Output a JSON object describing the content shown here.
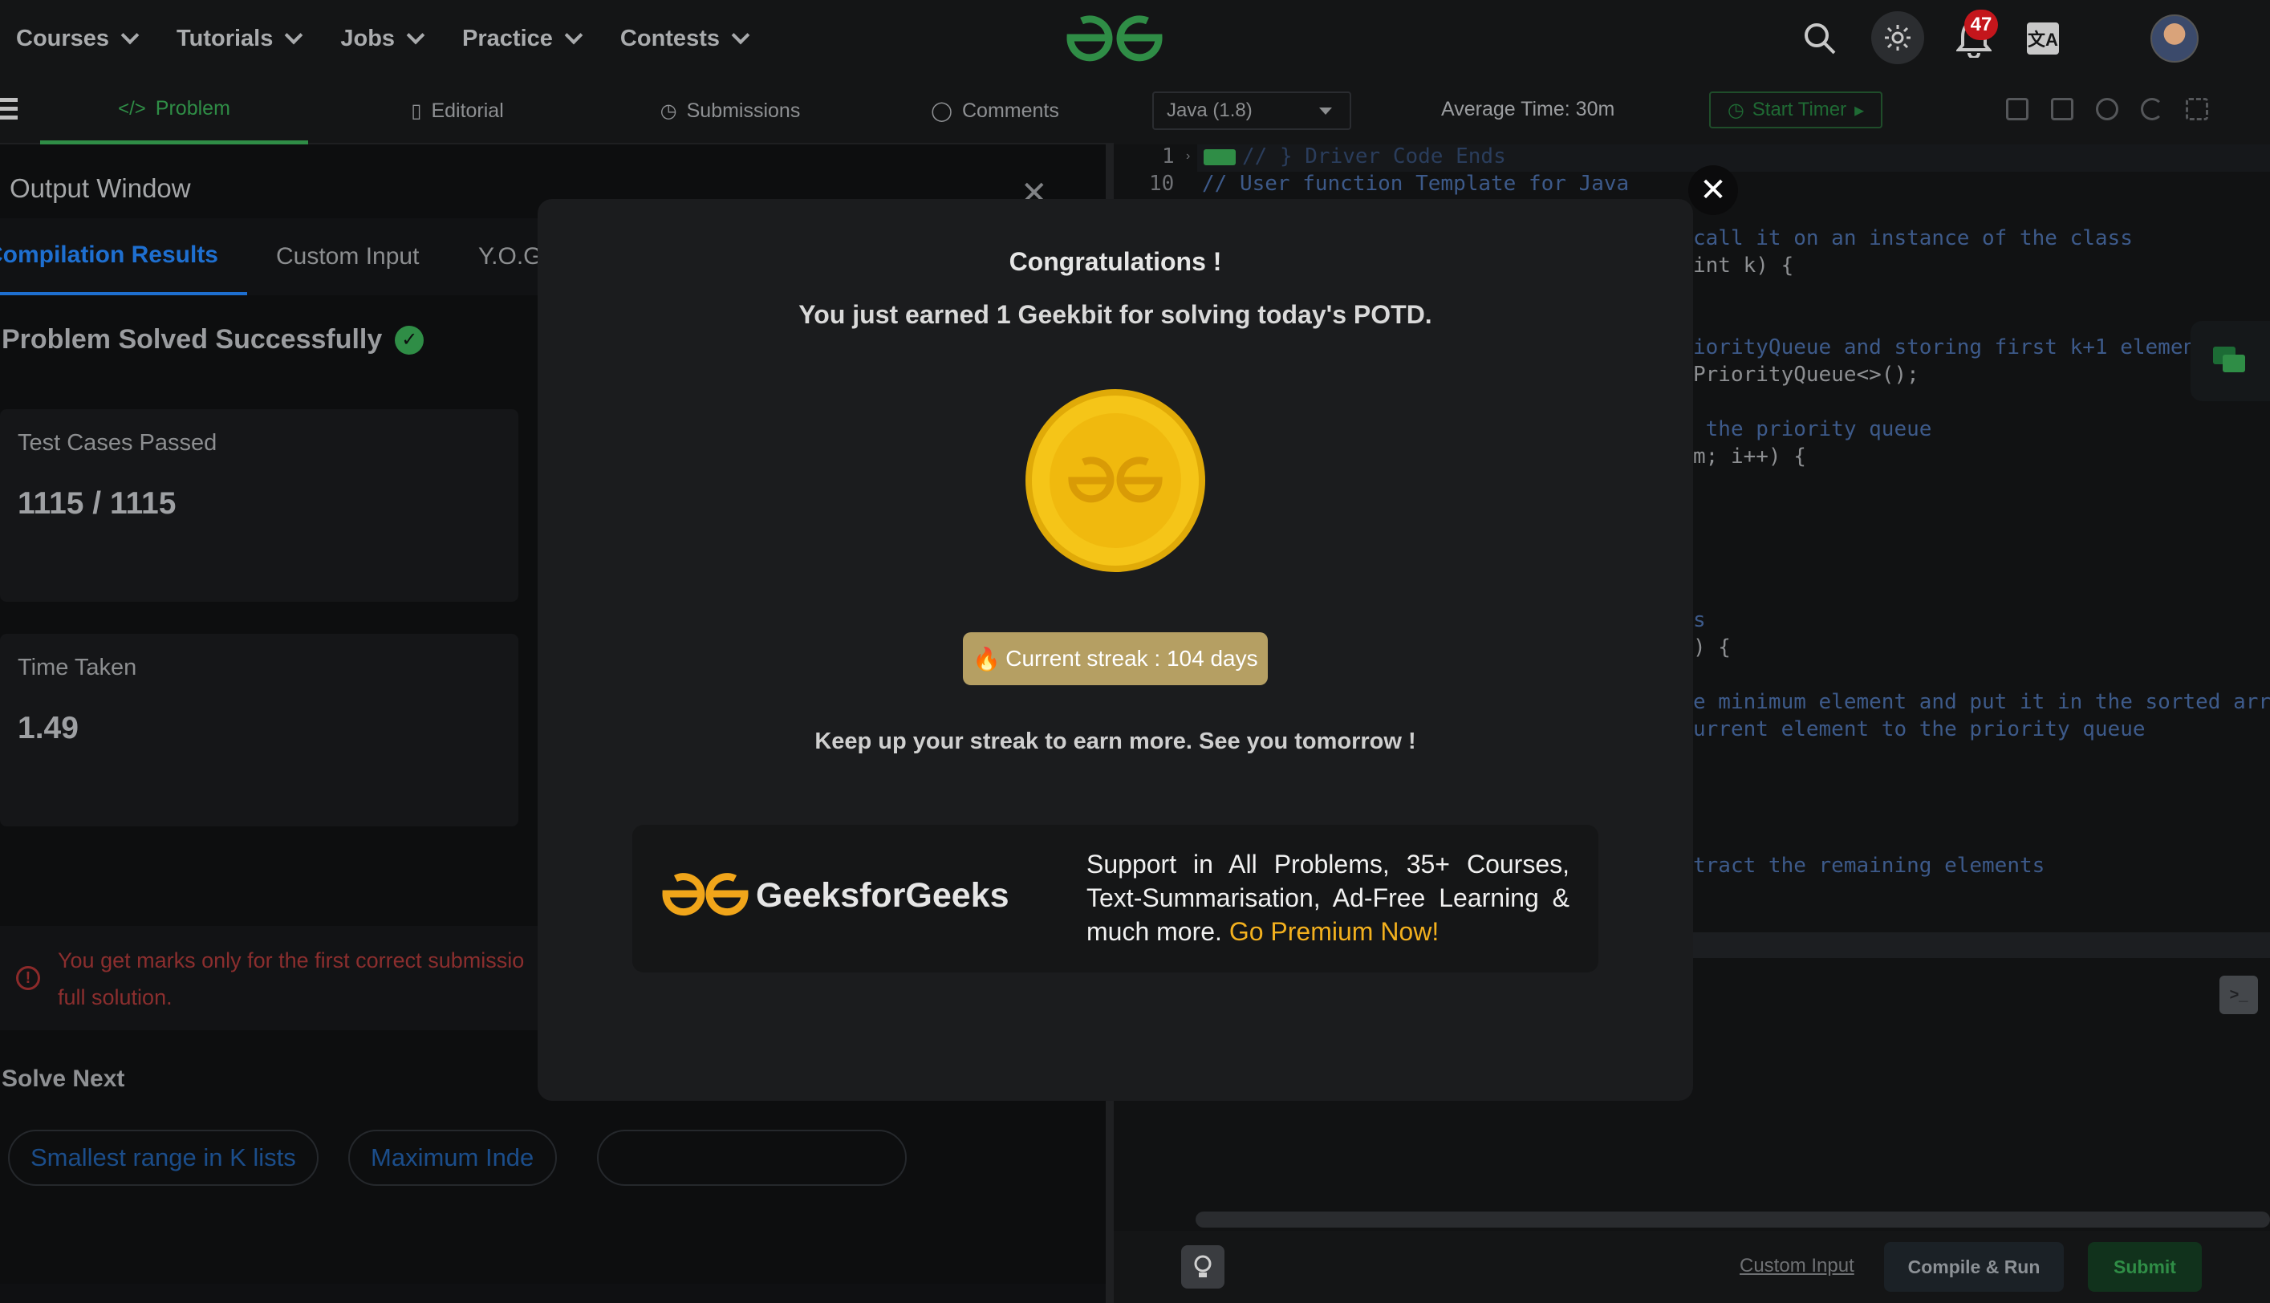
{
  "nav": {
    "menus": [
      "Courses",
      "Tutorials",
      "Jobs",
      "Practice",
      "Contests"
    ],
    "notification_count": "47",
    "icons": [
      "search-icon",
      "theme-toggle-icon",
      "bell-icon",
      "translate-icon",
      "avatar"
    ]
  },
  "problem_tabs": {
    "items": [
      {
        "label": "Problem",
        "icon": "code-icon"
      },
      {
        "label": "Editorial",
        "icon": "document-icon"
      },
      {
        "label": "Submissions",
        "icon": "clock-icon"
      },
      {
        "label": "Comments",
        "icon": "comment-icon"
      }
    ]
  },
  "output": {
    "title": "Output Window",
    "tabs": [
      "Compilation Results",
      "Custom Input",
      "Y.O.G"
    ],
    "status": "Problem Solved Successfully",
    "cards": [
      {
        "label": "Test Cases Passed",
        "value": "1115 / 1115"
      },
      {
        "label": "Time Taken",
        "value": "1.49"
      }
    ],
    "warning_line1": "You get marks only for the first correct submissio",
    "warning_line2": "full solution.",
    "solve_next_title": "Solve Next",
    "solve_next": [
      "Smallest range in K lists",
      "Maximum Inde"
    ]
  },
  "editor": {
    "language": "Java (1.8)",
    "average_time": "Average Time: 30m",
    "start_timer": "Start Timer",
    "lines": [
      {
        "no": "1",
        "text": "// } Driver Code Ends"
      },
      {
        "no": "10",
        "text": "// User function Template for Java"
      }
    ],
    "fragments": [
      "call it on an instance of the class",
      "int k) {",
      "iorityQueue and storing first k+1 elemen",
      "PriorityQueue<>();",
      " the priority queue",
      "m; i++) {",
      "s",
      ") {",
      "e minimum element and put it in the sorted arra",
      "urrent element to the priority queue",
      "tract the remaining elements"
    ],
    "custom_input": "Custom Input",
    "compile_run": "Compile & Run",
    "submit": "Submit"
  },
  "modal": {
    "title": "Congratulations !",
    "subtitle": "You just earned 1 Geekbit for solving today's POTD.",
    "streak": "Current streak : 104 days",
    "message": "Keep up your streak to earn more. See you tomorrow !",
    "promo_brand": "GeeksforGeeks",
    "promo_text": "Support in All Problems, 35+ Courses, Text-Summarisation, Ad-Free Learning & much more.",
    "promo_cta": "Go Premium Now!"
  },
  "colors": {
    "brand_green": "#2f8d46",
    "coin_gold": "#f5c518",
    "cta_yellow": "#f2b01e",
    "link_blue": "#1e6fd0",
    "notification_red": "#c4161c"
  }
}
